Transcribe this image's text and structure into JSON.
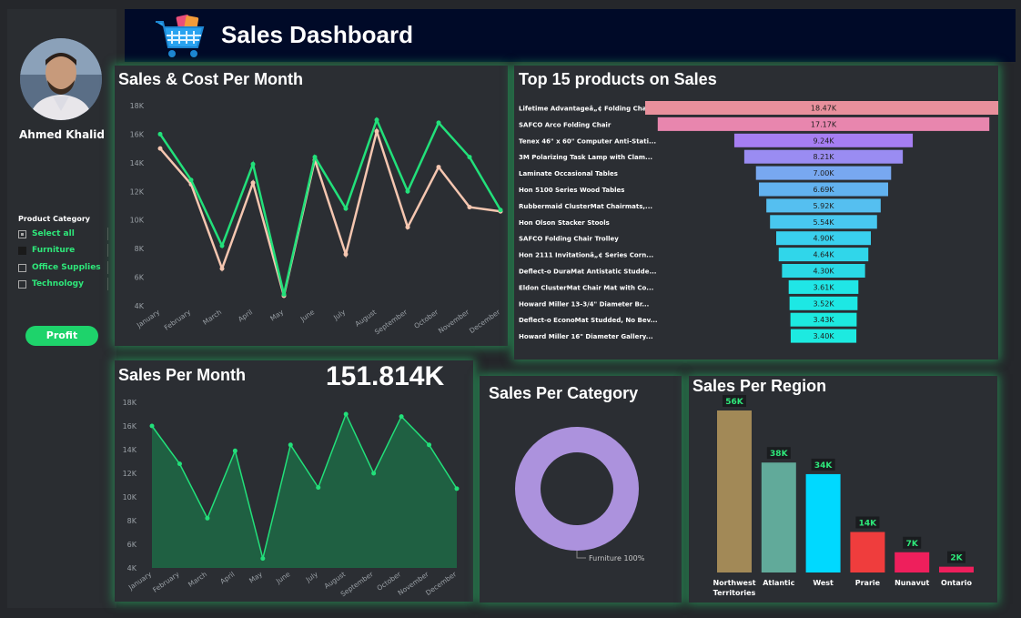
{
  "header": {
    "title": "Sales Dashboard",
    "icon": "shopping-cart-icon"
  },
  "sidebar": {
    "user_name": "Ahmed Khalid",
    "filter_title": "Product Category",
    "filters": [
      {
        "label": "Select all",
        "state": "partial"
      },
      {
        "label": "Furniture",
        "state": "filled"
      },
      {
        "label": "Office Supplies",
        "state": "empty"
      },
      {
        "label": "Technology",
        "state": "empty"
      }
    ],
    "profit_button": "Profit"
  },
  "colors": {
    "accent_green": "#2ee87a",
    "sales_line": "#22e07a",
    "cost_line": "#f5c6b0",
    "area_fill": "#1f6042",
    "donut": "#ac92dd"
  },
  "panels": {
    "sales_cost": {
      "title": "Sales & Cost Per Month"
    },
    "top_products": {
      "title": "Top 15 products on Sales"
    },
    "sales_month": {
      "title": "Sales Per Month",
      "kpi": "151.814K"
    },
    "category": {
      "title": "Sales Per Category"
    },
    "region": {
      "title": "Sales Per Region"
    }
  },
  "chart_data": [
    {
      "type": "line",
      "title": "Sales & Cost Per Month",
      "categories": [
        "January",
        "February",
        "March",
        "April",
        "May",
        "June",
        "July",
        "August",
        "September",
        "October",
        "November",
        "December"
      ],
      "y_ticks": [
        "4K",
        "6K",
        "8K",
        "10K",
        "12K",
        "14K",
        "16K",
        "18K"
      ],
      "ylim": [
        4000,
        18000
      ],
      "series": [
        {
          "values": [
            16000,
            12800,
            8200,
            13900,
            4800,
            14400,
            10800,
            17000,
            12000,
            16800,
            14400,
            10700
          ]
        },
        {
          "values": [
            15000,
            12500,
            6600,
            12600,
            4700,
            14200,
            7600,
            16200,
            9500,
            13700,
            10900,
            10600
          ]
        }
      ]
    },
    {
      "type": "bar",
      "orientation": "horizontal-funnel",
      "title": "Top 15 products on Sales",
      "categories": [
        "Lifetime Advantageâ„¢ Folding Chai...",
        "SAFCO Arco Folding Chair",
        "Tenex 46\" x 60\" Computer Anti-Stati...",
        "3M Polarizing Task Lamp with Clam...",
        "Laminate Occasional Tables",
        "Hon 5100 Series Wood Tables",
        "Rubbermaid ClusterMat Chairmats,...",
        "Hon Olson Stacker Stools",
        "SAFCO Folding Chair Trolley",
        "Hon 2111 Invitationâ„¢ Series Corn...",
        "Deflect-o DuraMat Antistatic Studde...",
        "Eldon ClusterMat Chair Mat with Co...",
        "Howard Miller 13-3/4\" Diameter Br...",
        "Deflect-o EconoMat Studded, No Bev...",
        "Howard Miller 16\" Diameter Gallery..."
      ],
      "values": [
        18470,
        17170,
        9240,
        8210,
        7000,
        6690,
        5920,
        5540,
        4900,
        4640,
        4300,
        3610,
        3520,
        3430,
        3400
      ],
      "labels": [
        "18.47K",
        "17.17K",
        "9.24K",
        "8.21K",
        "7.00K",
        "6.69K",
        "5.92K",
        "5.54K",
        "4.90K",
        "4.64K",
        "4.30K",
        "3.61K",
        "3.52K",
        "3.43K",
        "3.40K"
      ],
      "colors": [
        "#e8909c",
        "#e886ae",
        "#a67ef2",
        "#9a8cf2",
        "#78a8f0",
        "#62b2ef",
        "#55bff0",
        "#48c8f0",
        "#39d0ee",
        "#30d6ea",
        "#2ad9e6",
        "#20e6e6",
        "#1de8e4",
        "#1deae0",
        "#1deae0"
      ]
    },
    {
      "type": "area",
      "title": "Sales Per Month",
      "categories": [
        "January",
        "February",
        "March",
        "April",
        "May",
        "June",
        "July",
        "August",
        "September",
        "October",
        "November",
        "December"
      ],
      "y_ticks": [
        "4K",
        "6K",
        "8K",
        "10K",
        "12K",
        "14K",
        "16K",
        "18K"
      ],
      "ylim": [
        4000,
        18000
      ],
      "values": [
        16000,
        12800,
        8200,
        13900,
        4800,
        14400,
        10800,
        17000,
        12000,
        16800,
        14400,
        10700
      ]
    },
    {
      "type": "pie",
      "title": "Sales Per Category",
      "slices": [
        {
          "name": "Furniture",
          "value": 100,
          "label": "Furniture 100%"
        }
      ]
    },
    {
      "type": "bar",
      "title": "Sales Per Region",
      "categories": [
        "Northwest Territories",
        "Atlantic",
        "West",
        "Prarie",
        "Nunavut",
        "Ontario"
      ],
      "values": [
        56000,
        38000,
        34000,
        14000,
        7000,
        2000
      ],
      "labels": [
        "56K",
        "38K",
        "34K",
        "14K",
        "7K",
        "2K"
      ],
      "colors": [
        "#a28957",
        "#61aa9a",
        "#00d9ff",
        "#ef3d3d",
        "#ee1f5c",
        "#ee1f5c"
      ]
    }
  ]
}
